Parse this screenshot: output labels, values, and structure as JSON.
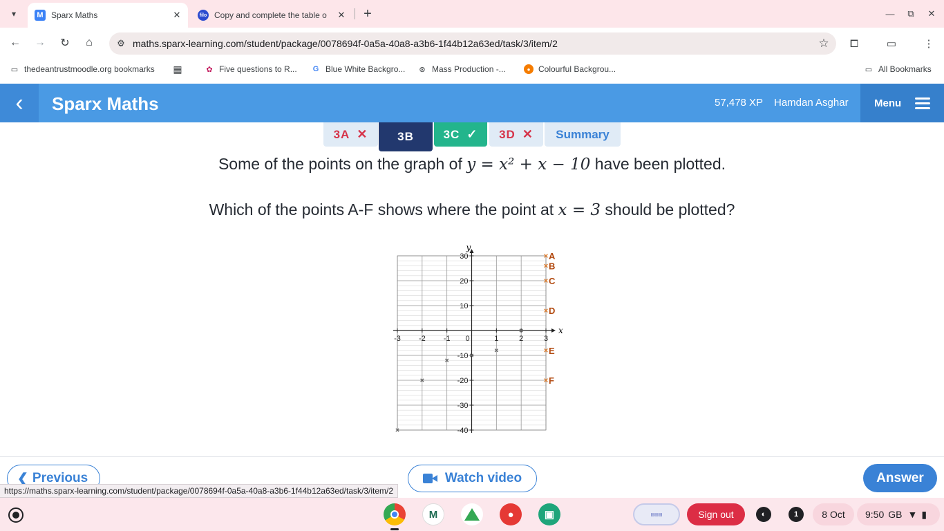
{
  "browser": {
    "tabs": [
      {
        "title": "Sparx Maths",
        "favicon": "M",
        "active": true
      },
      {
        "title": "Copy and complete the table o",
        "favicon": "filo",
        "active": false
      }
    ],
    "url": "maths.sparx-learning.com/student/package/0078694f-0a5a-40a8-a3b6-1f44b12a63ed/task/3/item/2",
    "bookmarks": [
      {
        "label": "thedeantrustmoodle.org bookmarks",
        "icon": "folder-icon"
      },
      {
        "label": "",
        "icon": "apps-grid-icon"
      },
      {
        "label": "Five questions to R...",
        "icon": "site-icon"
      },
      {
        "label": "Blue White Backgro...",
        "icon": "google-icon"
      },
      {
        "label": "Mass Production -...",
        "icon": "openai-icon"
      },
      {
        "label": "Colourful Backgrou...",
        "icon": "site-icon"
      }
    ],
    "all_bookmarks": "All Bookmarks",
    "status_url": "https://maths.sparx-learning.com/student/package/0078694f-0a5a-40a8-a3b6-1f44b12a63ed/task/3/item/2"
  },
  "header": {
    "title": "Sparx Maths",
    "xp": "57,478 XP",
    "user": "Hamdan Asghar",
    "menu": "Menu"
  },
  "task_tabs": [
    {
      "label": "3A",
      "status": "wrong",
      "mark": "✕"
    },
    {
      "label": "3B",
      "status": "current",
      "mark": ""
    },
    {
      "label": "3C",
      "status": "correct",
      "mark": "✓"
    },
    {
      "label": "3D",
      "status": "wrong",
      "mark": "✕"
    },
    {
      "label": "Summary",
      "status": "summary",
      "mark": ""
    }
  ],
  "question": {
    "line1_before": "Some of the points on the graph of ",
    "line1_math": "y = x² + x − 10",
    "line1_after": " have been plotted.",
    "line2_before": "Which of the points A-F shows where the point at ",
    "line2_math": "x = 3",
    "line2_after": " should be plotted?"
  },
  "chart_data": {
    "type": "scatter",
    "xlabel": "x",
    "ylabel": "y",
    "xlim": [
      -3,
      3
    ],
    "ylim": [
      -40,
      30
    ],
    "x_ticks": [
      -3,
      -2,
      -1,
      0,
      1,
      2,
      3
    ],
    "y_ticks": [
      -40,
      -30,
      -20,
      -10,
      10,
      20,
      30
    ],
    "x_tick_labels": [
      "-3",
      "-2",
      "-1",
      "0",
      "1",
      "2",
      "3"
    ],
    "y_tick_labels": [
      "-40",
      "-30",
      "-20",
      "-10",
      "10",
      "20",
      "30"
    ],
    "grid": true,
    "plotted_points": [
      {
        "x": -3,
        "y": -40
      },
      {
        "x": -2,
        "y": -20
      },
      {
        "x": -1,
        "y": -12
      },
      {
        "x": 0,
        "y": -10
      },
      {
        "x": 1,
        "y": -8
      },
      {
        "x": 2,
        "y": 0
      }
    ],
    "options": [
      {
        "label": "A",
        "x": 3,
        "y": 30
      },
      {
        "label": "B",
        "x": 3,
        "y": 26
      },
      {
        "label": "C",
        "x": 3,
        "y": 20
      },
      {
        "label": "D",
        "x": 3,
        "y": 8
      },
      {
        "label": "E",
        "x": 3,
        "y": -8
      },
      {
        "label": "F",
        "x": 3,
        "y": -20
      }
    ],
    "colors": {
      "points": "#666666",
      "options": "#e07b2a",
      "option_labels": "#b24a10"
    }
  },
  "actions": {
    "previous": "Previous",
    "watch_video": "Watch video",
    "answer": "Answer"
  },
  "shelf": {
    "sign_out": "Sign out",
    "notifications": "1",
    "date": "8 Oct",
    "time": "9:50",
    "locale": "GB"
  },
  "colors": {
    "sparx_blue": "#4a9ae4",
    "accent_blue": "#3a82d6",
    "current_tab": "#22386e",
    "correct_green": "#23b58c",
    "wrong_red": "#d6344a"
  }
}
